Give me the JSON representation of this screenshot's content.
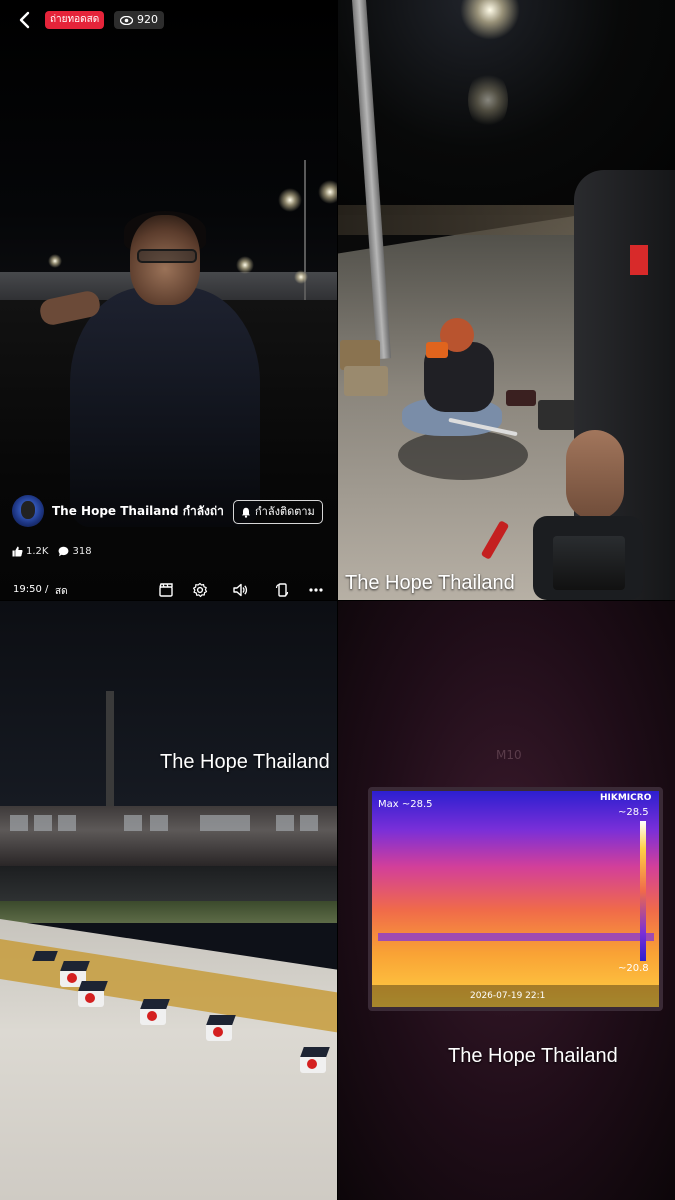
{
  "live_view": {
    "back_label": "Back",
    "live_badge": "ถ่ายทอดสด",
    "viewer_count": "920",
    "channel_name": "The Hope Thailand กำลังถ่า...",
    "follow_label": "กำลังติดตาม",
    "likes": "1.2K",
    "comments": "318",
    "time": "19:50 /",
    "status": "สด",
    "icons": [
      "chevron-left-icon",
      "eye-icon",
      "bell-icon",
      "thumbs-up-icon",
      "comment-icon",
      "clapperboard-icon",
      "gear-icon",
      "speaker-icon",
      "rotate-icon",
      "more-icon"
    ]
  },
  "watermarks": {
    "top_right": "The Hope Thailand",
    "bottom_left": "The Hope Thailand",
    "bottom_right": "The Hope Thailand"
  },
  "thermal": {
    "device_label": "M10",
    "brand": "HIKMICRO",
    "max_label": "Max ~28.5",
    "scale_high": "~28.5",
    "scale_low": "~20.8",
    "timestamp": "2026-07-19 22:1",
    "colors": {
      "cold": "#2c1fd0",
      "mid": "#d23f9a",
      "hot": "#ffd044"
    }
  },
  "colors": {
    "live_red": "#e5243a",
    "background": "#000000"
  }
}
